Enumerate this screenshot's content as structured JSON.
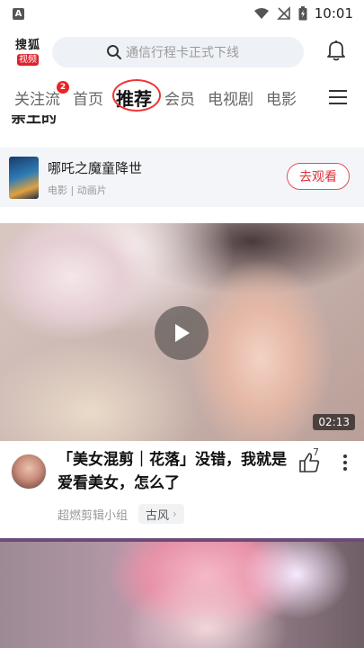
{
  "status_bar": {
    "notification_letter": "A",
    "time": "10:01"
  },
  "header": {
    "logo_top": "搜狐",
    "logo_bottom": "视频",
    "search_placeholder": "通信行程卡正式下线"
  },
  "tabs": [
    {
      "label": "关注流",
      "badge": "2"
    },
    {
      "label": "首页"
    },
    {
      "label": "推荐",
      "active": true
    },
    {
      "label": "会员"
    },
    {
      "label": "电视剧"
    },
    {
      "label": "电影"
    }
  ],
  "section_heading": "亲王的",
  "movie_card": {
    "title": "哪吒之魔童降世",
    "meta": "电影 | 动画片",
    "button": "去观看"
  },
  "video1": {
    "duration": "02:13"
  },
  "post": {
    "title": "「美女混剪｜花落」没错，我就是爱看美女，怎么了",
    "like_count": "7",
    "author": "超燃剪辑小组",
    "tag": "古风"
  }
}
